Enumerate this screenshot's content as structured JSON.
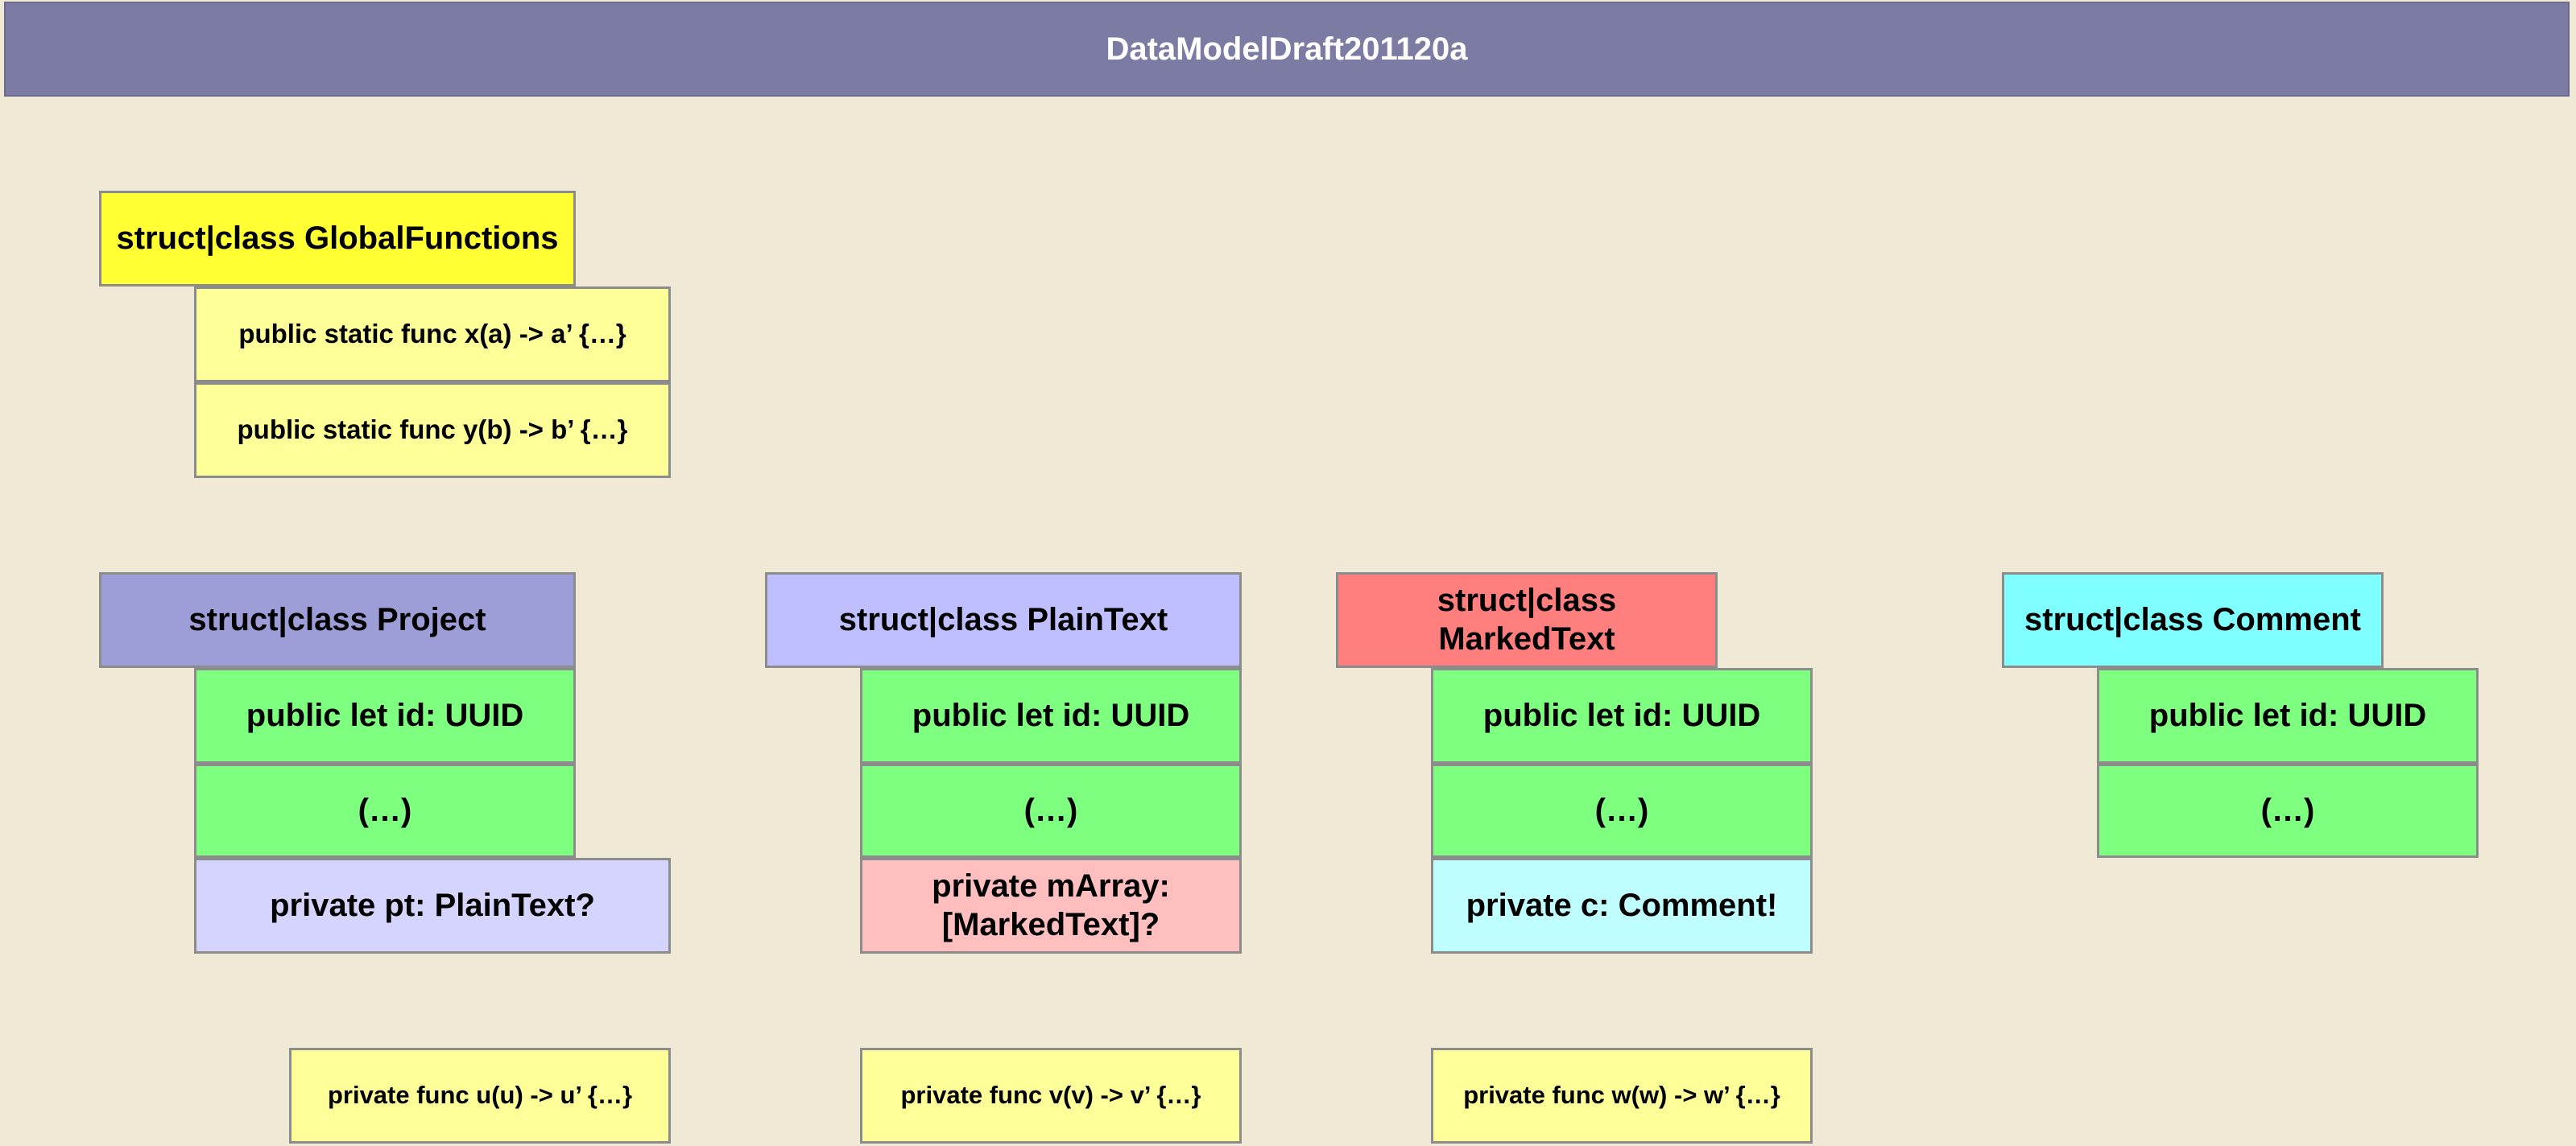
{
  "diagram": {
    "title": "DataModelDraft201120a",
    "colors": {
      "background": "#f0e9d6",
      "title_bar": "#7b7ba3",
      "global_header": "#ffff33",
      "func_box": "#ffff99",
      "project_header": "#9d9dd8",
      "plaintext_header": "#bfbfff",
      "markedtext_header": "#ff7f7f",
      "comment_header": "#7fffff",
      "member_green": "#7fff7f",
      "ref_plaintext": "#d4d4ff",
      "ref_markedtext": "#ffbfbf",
      "ref_comment": "#bfffff"
    },
    "global": {
      "header": "struct|class GlobalFunctions",
      "func_x": "public static func x(a) -> a’ {…}",
      "func_y": "public static func y(b) -> b’ {…}"
    },
    "project": {
      "header": "struct|class Project",
      "id": "public let id: UUID",
      "etc": "(…)",
      "ref": "private pt: PlainText?",
      "func": "private func u(u) -> u’ {…}"
    },
    "plaintext": {
      "header": "struct|class PlainText",
      "id": "public let id: UUID",
      "etc": "(…)",
      "ref": "private mArray: [MarkedText]?",
      "func": "private func v(v) -> v’ {…}"
    },
    "markedtext": {
      "header": "struct|class MarkedText",
      "id": "public let id: UUID",
      "etc": "(…)",
      "ref": "private c: Comment!",
      "func": "private func w(w) -> w’ {…}"
    },
    "comment": {
      "header": "struct|class Comment",
      "id": "public let id: UUID",
      "etc": "(…)"
    }
  }
}
